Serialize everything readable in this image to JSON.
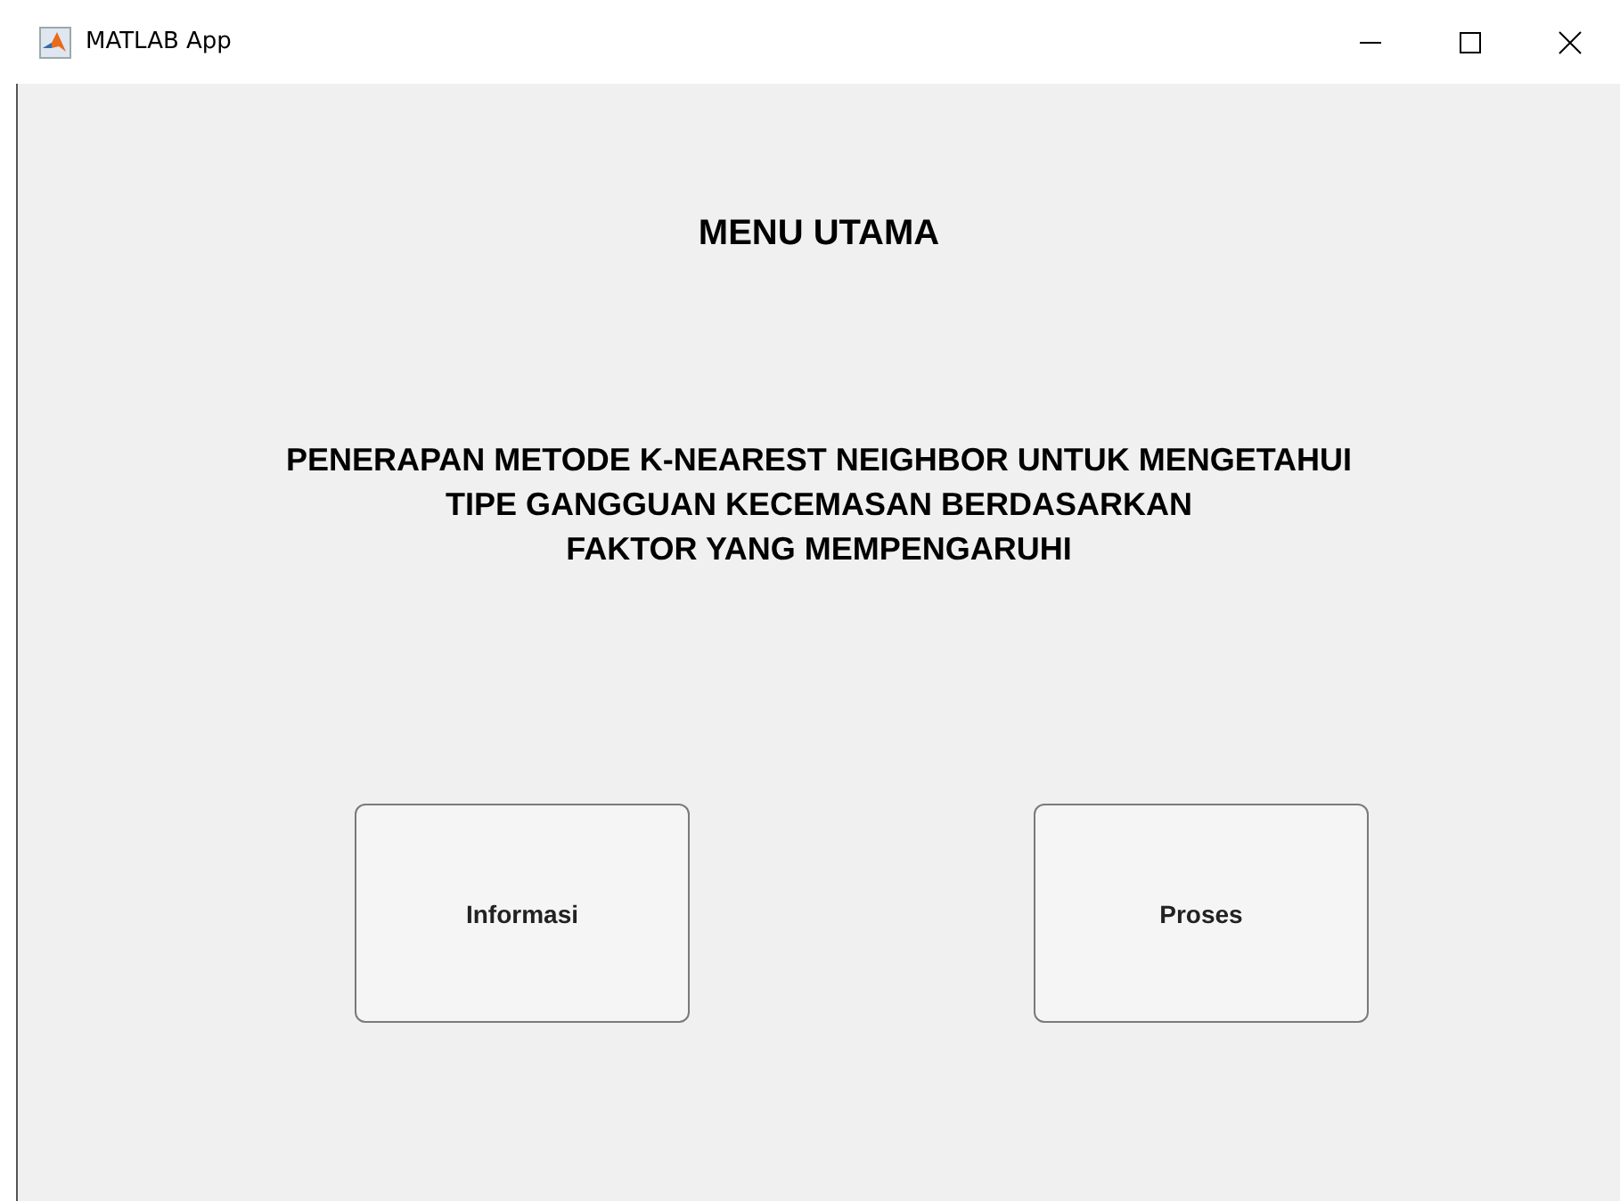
{
  "window": {
    "title": "MATLAB App"
  },
  "heading": "MENU UTAMA",
  "subtitle_lines": [
    "PENERAPAN METODE K-NEAREST NEIGHBOR UNTUK MENGETAHUI",
    "TIPE GANGGUAN KECEMASAN BERDASARKAN",
    "FAKTOR YANG MEMPENGARUHI"
  ],
  "buttons": [
    "Informasi",
    "Proses"
  ]
}
